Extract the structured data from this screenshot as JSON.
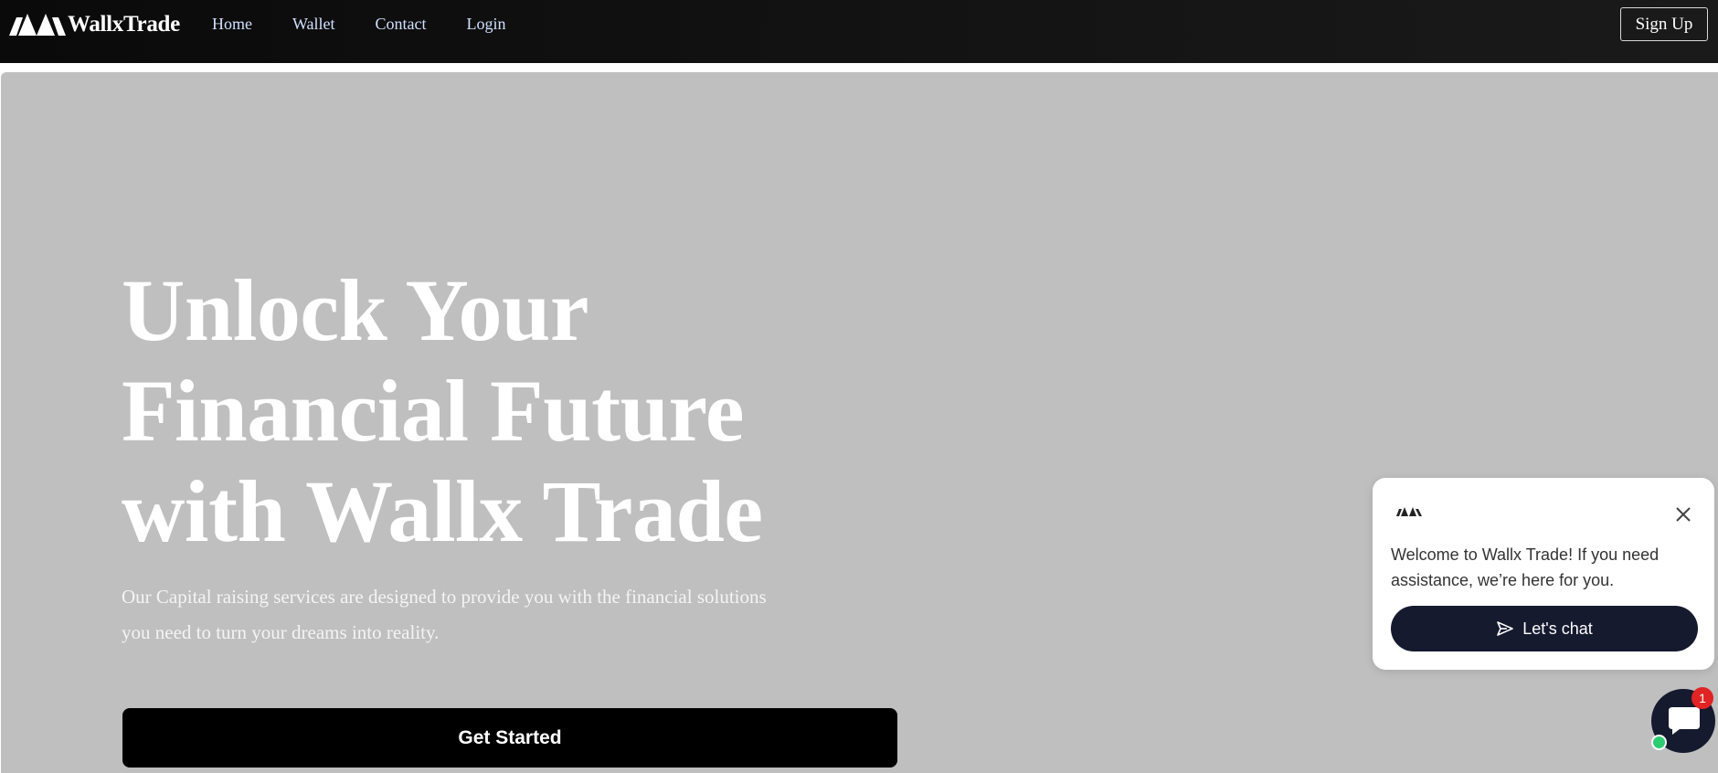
{
  "header": {
    "brand_name": "WallxTrade",
    "nav": [
      {
        "label": "Home"
      },
      {
        "label": "Wallet"
      },
      {
        "label": "Contact"
      },
      {
        "label": "Login"
      }
    ],
    "signup_label": "Sign Up"
  },
  "hero": {
    "title_lines": [
      "Unlock Your",
      "Financial Future",
      "with Wallx Trade"
    ],
    "subtitle": "Our Capital raising services are designed to provide you with the financial solutions you need to turn your dreams into reality.",
    "cta_label": "Get Started"
  },
  "chat": {
    "message": "Welcome to Wallx Trade! If you need assistance, we’re here for you.",
    "button_label": "Let's chat",
    "badge_count": "1",
    "icons": {
      "logo": "wallx-logo-icon",
      "close": "close-icon",
      "send": "send-icon",
      "launcher": "chat-bubble-icon"
    }
  },
  "colors": {
    "header_bg": "#0a0a0a",
    "hero_bg": "#bfbfbf",
    "cta_bg": "#000000",
    "chat_button_bg": "#161a2e",
    "badge_bg": "#e02424",
    "online": "#2ecc71",
    "nav_link": "#cfe0ff"
  }
}
